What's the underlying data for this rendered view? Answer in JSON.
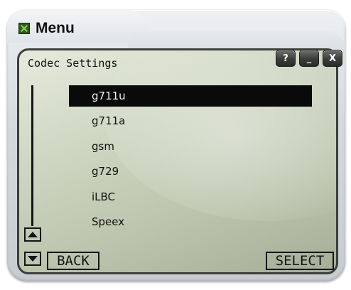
{
  "window": {
    "title": "Menu",
    "logo_icon": "app-logo-icon"
  },
  "window_controls": {
    "help_label": "?",
    "minimize_label": "_",
    "close_label": "X"
  },
  "screen": {
    "title": "Codec Settings",
    "background": "#c8d0bb"
  },
  "codecs": {
    "selected_index": 0,
    "items": [
      "g711u",
      "g711a",
      "gsm",
      "g729",
      "iLBC",
      "Speex"
    ]
  },
  "softkeys": {
    "left_label": "BACK",
    "right_label": "SELECT"
  },
  "icons": {
    "scroll_up": "scroll-up-arrow-icon",
    "scroll_down": "scroll-down-arrow-icon"
  }
}
